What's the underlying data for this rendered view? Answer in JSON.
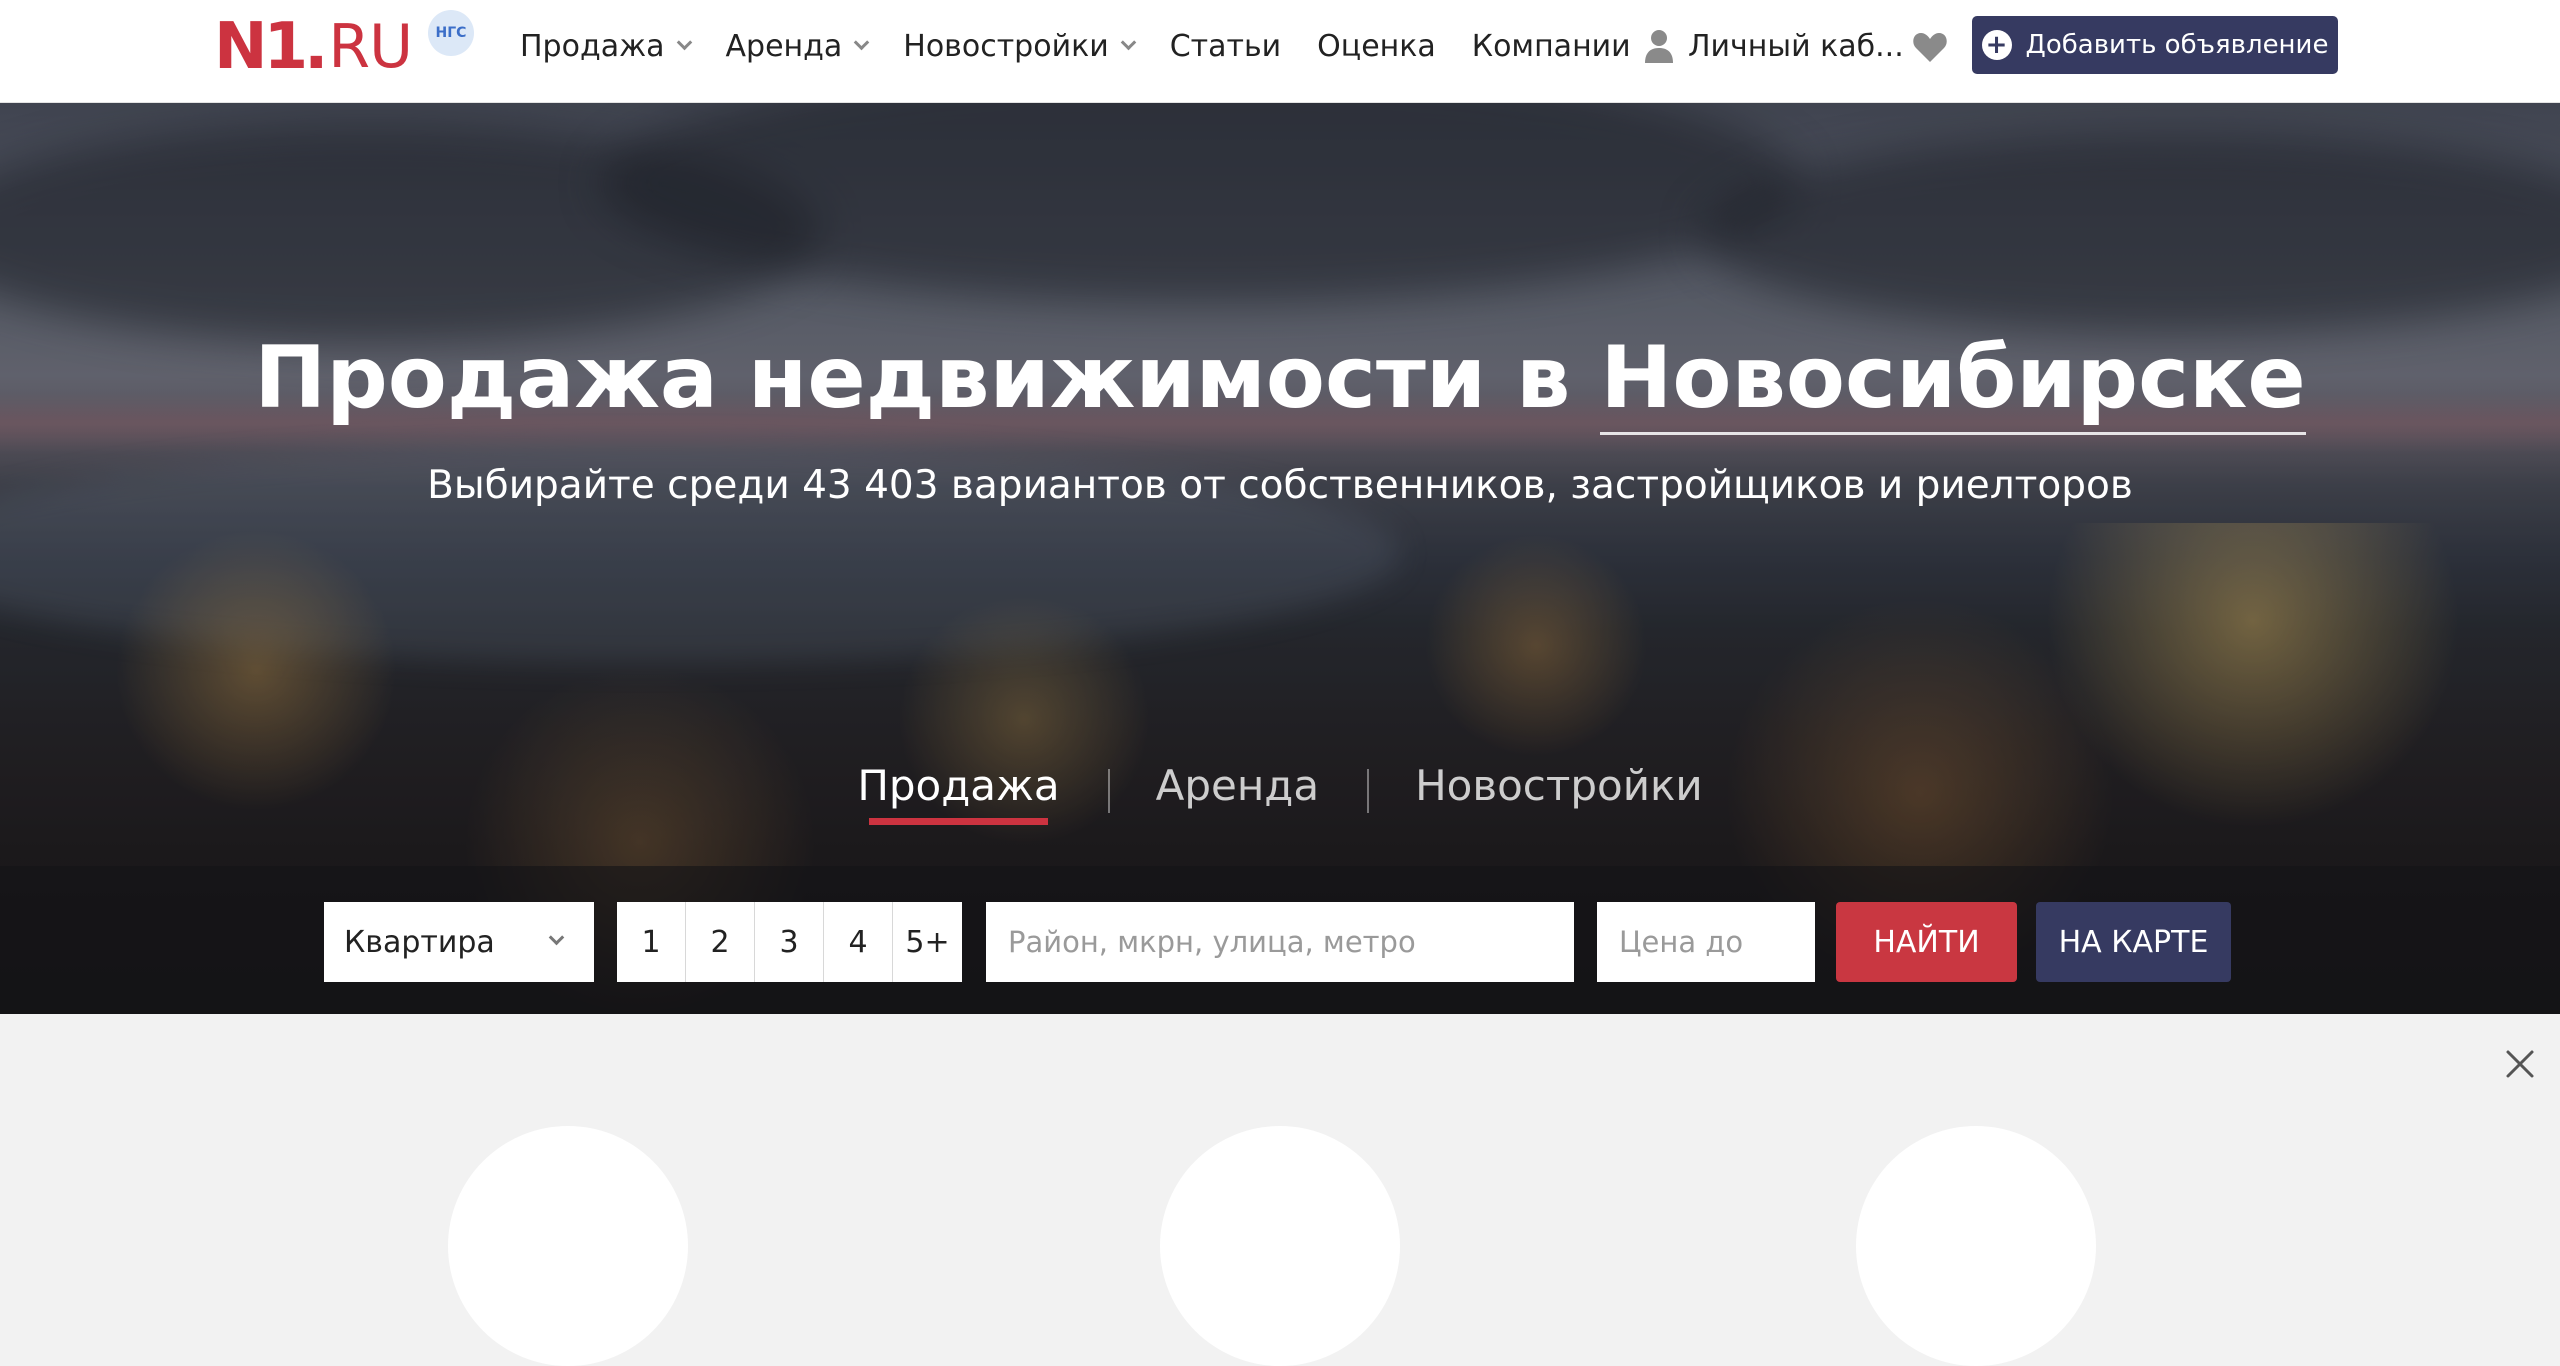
{
  "header": {
    "logo": {
      "brand": "N1",
      "dot": ".",
      "tld": "RU",
      "badge": "НГС"
    },
    "nav": [
      {
        "label": "Продажа",
        "has_dropdown": true
      },
      {
        "label": "Аренда",
        "has_dropdown": true
      },
      {
        "label": "Новостройки",
        "has_dropdown": true
      },
      {
        "label": "Статьи",
        "has_dropdown": false
      },
      {
        "label": "Оценка",
        "has_dropdown": false
      },
      {
        "label": "Компании",
        "has_dropdown": false
      }
    ],
    "cabinet_label": "Личный каб...",
    "favorites_icon": "heart-icon",
    "add_button_label": "Добавить объявление"
  },
  "hero": {
    "title_prefix": "Продажа недвижимости в",
    "title_city": "Новосибирске",
    "subtitle": "Выбирайте среди 43 403 вариантов от собственников, застройщиков и риелторов",
    "tabs": [
      {
        "label": "Продажа",
        "active": true
      },
      {
        "label": "Аренда",
        "active": false
      },
      {
        "label": "Новостройки",
        "active": false
      }
    ]
  },
  "search": {
    "type_value": "Квартира",
    "rooms": [
      "1",
      "2",
      "3",
      "4",
      "5+"
    ],
    "address_placeholder": "Район, мкрн, улица, метро",
    "price_placeholder": "Цена до",
    "find_label": "НАЙТИ",
    "map_label": "НА КАРТЕ"
  },
  "colors": {
    "brand_red": "#cc3340",
    "navy": "#363a61",
    "find_red": "#c93741"
  }
}
